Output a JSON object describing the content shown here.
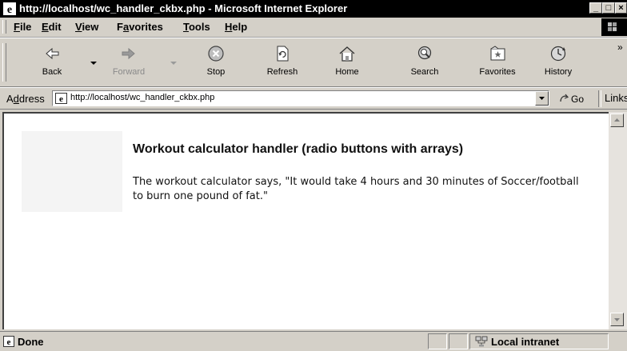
{
  "window": {
    "title": "http://localhost/wc_handler_ckbx.php - Microsoft Internet Explorer",
    "minimize_glyph": "_",
    "maximize_glyph": "□",
    "close_glyph": "×"
  },
  "menu": {
    "items": [
      {
        "label_pre": "",
        "label_u": "F",
        "label_post": "ile"
      },
      {
        "label_pre": "",
        "label_u": "E",
        "label_post": "dit"
      },
      {
        "label_pre": "",
        "label_u": "V",
        "label_post": "iew"
      },
      {
        "label_pre": "F",
        "label_u": "a",
        "label_post": "vorites"
      },
      {
        "label_pre": "",
        "label_u": "T",
        "label_post": "ools"
      },
      {
        "label_pre": "",
        "label_u": "H",
        "label_post": "elp"
      }
    ]
  },
  "toolbar": {
    "buttons": [
      {
        "label": "Back",
        "icon": "back-arrow-icon",
        "enabled": true
      },
      {
        "label": "Forward",
        "icon": "forward-arrow-icon",
        "enabled": false
      },
      {
        "label": "Stop",
        "icon": "stop-icon",
        "enabled": true
      },
      {
        "label": "Refresh",
        "icon": "refresh-icon",
        "enabled": true
      },
      {
        "label": "Home",
        "icon": "home-icon",
        "enabled": true
      },
      {
        "label": "Search",
        "icon": "search-icon",
        "enabled": true
      },
      {
        "label": "Favorites",
        "icon": "favorites-icon",
        "enabled": true
      },
      {
        "label": "History",
        "icon": "history-icon",
        "enabled": true
      }
    ],
    "overflow_glyph": "»"
  },
  "address": {
    "label_pre": "A",
    "label_u": "d",
    "label_post": "dress",
    "url": "http://localhost/wc_handler_ckbx.php",
    "go_label": "Go",
    "links_label": "Links"
  },
  "page": {
    "heading": "Workout calculator handler (radio buttons with arrays)",
    "message": "The workout calculator says, \"It would take 4 hours and 30 minutes of Soccer/football to burn one pound of fat.\""
  },
  "status": {
    "text": "Done",
    "zone": "Local intranet"
  },
  "colors": {
    "chrome": "#d4d0c8",
    "titlebar": "#000000",
    "content_bg": "#ffffff",
    "placeholder": "#f4f4f4"
  }
}
